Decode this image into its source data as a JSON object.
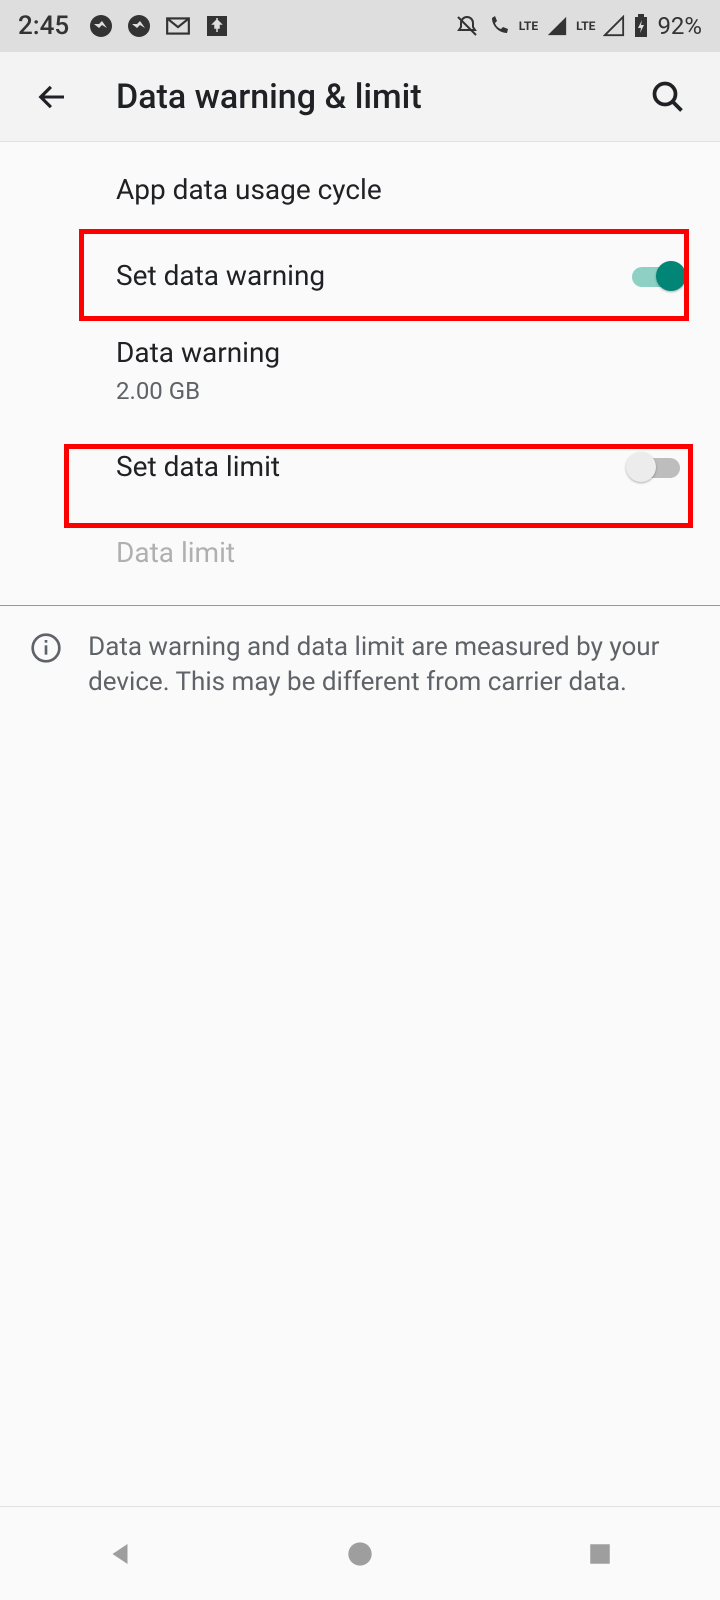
{
  "status": {
    "time": "2:45",
    "battery": "92%"
  },
  "header": {
    "title": "Data warning & limit"
  },
  "rows": {
    "usage_cycle": {
      "title": "App data usage cycle"
    },
    "set_warning": {
      "title": "Set data warning"
    },
    "data_warning": {
      "title": "Data warning",
      "value": "2.00 GB"
    },
    "set_limit": {
      "title": "Set data limit"
    },
    "data_limit": {
      "title": "Data limit"
    }
  },
  "info": {
    "text": "Data warning and data limit are measured by your device. This may be different from carrier data."
  }
}
